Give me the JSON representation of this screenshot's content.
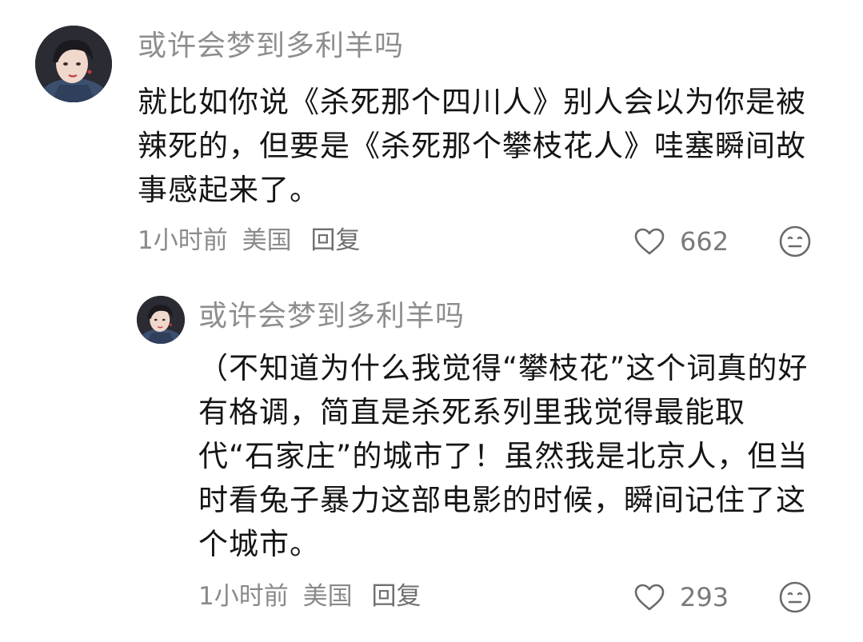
{
  "comments": [
    {
      "username": "或许会梦到多利羊吗",
      "text": "就比如你说《杀死那个四川人》别人会以为你是被辣死的，但要是《杀死那个攀枝花人》哇塞瞬间故事感起来了。",
      "time": "1小时前",
      "location": "美国",
      "reply_label": "回复",
      "likes": "662"
    },
    {
      "username": "或许会梦到多利羊吗",
      "text": "（不知道为什么我觉得“攀枝花”这个词真的好有格调，简直是杀死系列里我觉得最能取代“石家庄”的城市了！虽然我是北京人，但当时看兔子暴力这部电影的时候，瞬间记住了这个城市。",
      "time": "1小时前",
      "location": "美国",
      "reply_label": "回复",
      "likes": "293"
    }
  ],
  "icons": {
    "like": "heart-outline-icon",
    "dislike": "neutral-face-icon",
    "avatar": "user-avatar"
  },
  "colors": {
    "username": "#8e8e8e",
    "body": "#151515",
    "meta": "#8a8a8a",
    "icon": "#6a6a6a"
  }
}
